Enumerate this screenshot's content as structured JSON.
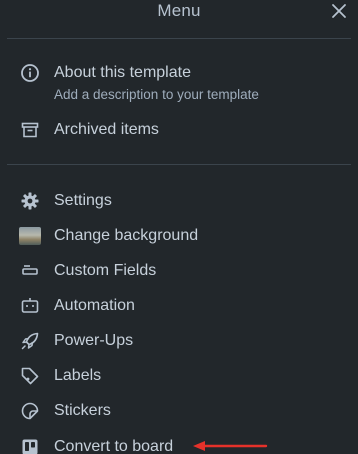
{
  "header": {
    "title": "Menu",
    "close_icon": "close-icon"
  },
  "about": {
    "label": "About this template",
    "description": "Add a description to your template",
    "icon": "info-icon"
  },
  "archived": {
    "label": "Archived items",
    "icon": "archive-icon"
  },
  "items": [
    {
      "label": "Settings",
      "icon": "gear-icon"
    },
    {
      "label": "Change background",
      "icon": "background-thumbnail"
    },
    {
      "label": "Custom Fields",
      "icon": "custom-fields-icon"
    },
    {
      "label": "Automation",
      "icon": "automation-icon"
    },
    {
      "label": "Power-Ups",
      "icon": "rocket-icon"
    },
    {
      "label": "Labels",
      "icon": "tag-icon"
    },
    {
      "label": "Stickers",
      "icon": "sticker-icon"
    },
    {
      "label": "Convert to board",
      "icon": "board-icon"
    }
  ],
  "colors": {
    "background": "#22272b",
    "text": "#c7d1db",
    "arrow": "#e5312a"
  }
}
